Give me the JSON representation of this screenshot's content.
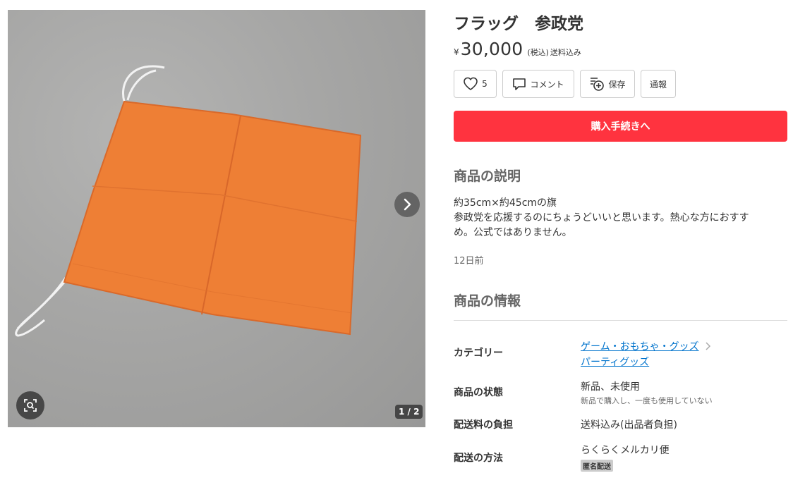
{
  "product": {
    "title": "フラッグ　参政党",
    "price_symbol": "¥",
    "price": "30,000",
    "tax_note": "(税込)",
    "shipping_note": "送料込み",
    "image_counter": "1 / 2"
  },
  "actions": {
    "like_count": "5",
    "comment_label": "コメント",
    "save_label": "保存",
    "report_label": "通報",
    "buy_label": "購入手続きへ",
    "buy_color": "#ff333f"
  },
  "description": {
    "heading": "商品の説明",
    "line1": "約35cm×約45cmの旗",
    "line2": "参政党を応援するのにちょうどいいと思います。熱心な方におすす",
    "line3": "め。公式ではありません。",
    "posted": "12日前"
  },
  "info": {
    "heading": "商品の情報",
    "category_label": "カテゴリー",
    "category_1": "ゲーム・おもちゃ・グッズ",
    "category_2": "パーティグッズ",
    "condition_label": "商品の状態",
    "condition_value": "新品、未使用",
    "condition_sub": "新品で購入し、一度も使用していない",
    "shipping_fee_label": "配送料の負担",
    "shipping_fee_value": "送料込み(出品者負担)",
    "shipping_method_label": "配送の方法",
    "shipping_method_value": "らくらくメルカリ便",
    "anonymous_badge": "匿名配送"
  },
  "icons": {
    "like": "heart-icon",
    "comment": "comment-icon",
    "save": "save-icon",
    "next": "chevron-right-icon",
    "zoom": "zoom-scan-icon",
    "category_arrow": "chevron-right-icon"
  }
}
